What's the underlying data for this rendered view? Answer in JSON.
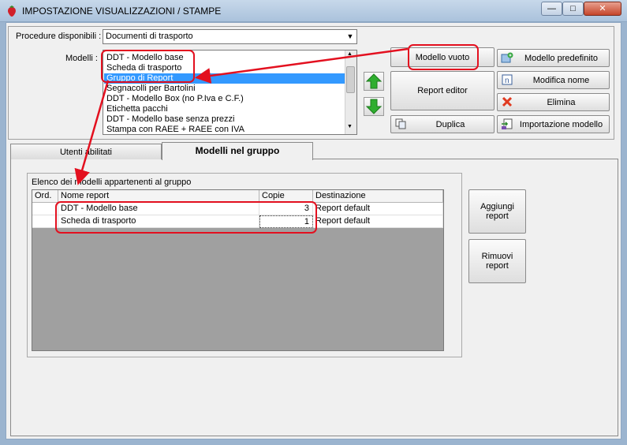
{
  "window": {
    "title": "IMPOSTAZIONE VISUALIZZAZIONI / STAMPE",
    "minimize_glyph": "—",
    "maximize_glyph": "□",
    "close_glyph": "✕",
    "icon": "strawberry-icon"
  },
  "top": {
    "procedure_label": "Procedure disponibili :",
    "procedure_value": "Documenti di trasporto",
    "modelli_label": "Modelli :",
    "models": [
      "DDT - Modello base",
      "Scheda di trasporto",
      "Gruppo di Report",
      "Segnacolli per Bartolini",
      "DDT - Modello Box (no P.Iva e C.F.)",
      "Etichetta pacchi",
      "DDT - Modello base senza prezzi",
      "Stampa con RAEE + RAEE con IVA"
    ],
    "selected_model": "Gruppo di Report"
  },
  "buttons": {
    "modello_vuoto": "Modello vuoto",
    "report_editor": "Report editor",
    "duplica": "Duplica",
    "modello_predefinito": "Modello predefinito",
    "modifica_nome": "Modifica nome",
    "elimina": "Elimina",
    "importazione_modello": "Importazione modello",
    "aggiungi_report": "Aggiungi report",
    "rimuovi_report": "Rimuovi report"
  },
  "tabs": [
    {
      "label": "Utenti abilitati",
      "active": false
    },
    {
      "label": "Modelli nel gruppo",
      "active": true
    }
  ],
  "group": {
    "caption": "Elenco dei modelli appartenenti al gruppo",
    "columns": [
      "Ord.",
      "Nome report",
      "Copie",
      "Destinazione"
    ],
    "rows": [
      {
        "ord": "",
        "nome": "DDT - Modello base",
        "copie": "3",
        "destinazione": "Report default"
      },
      {
        "ord": "",
        "nome": "Scheda di trasporto",
        "copie": "1",
        "destinazione": "Report default"
      }
    ]
  },
  "colors": {
    "annotation_red": "#e3101f",
    "selection_blue": "#3399ff",
    "arrow_green": "#2fae2f"
  }
}
